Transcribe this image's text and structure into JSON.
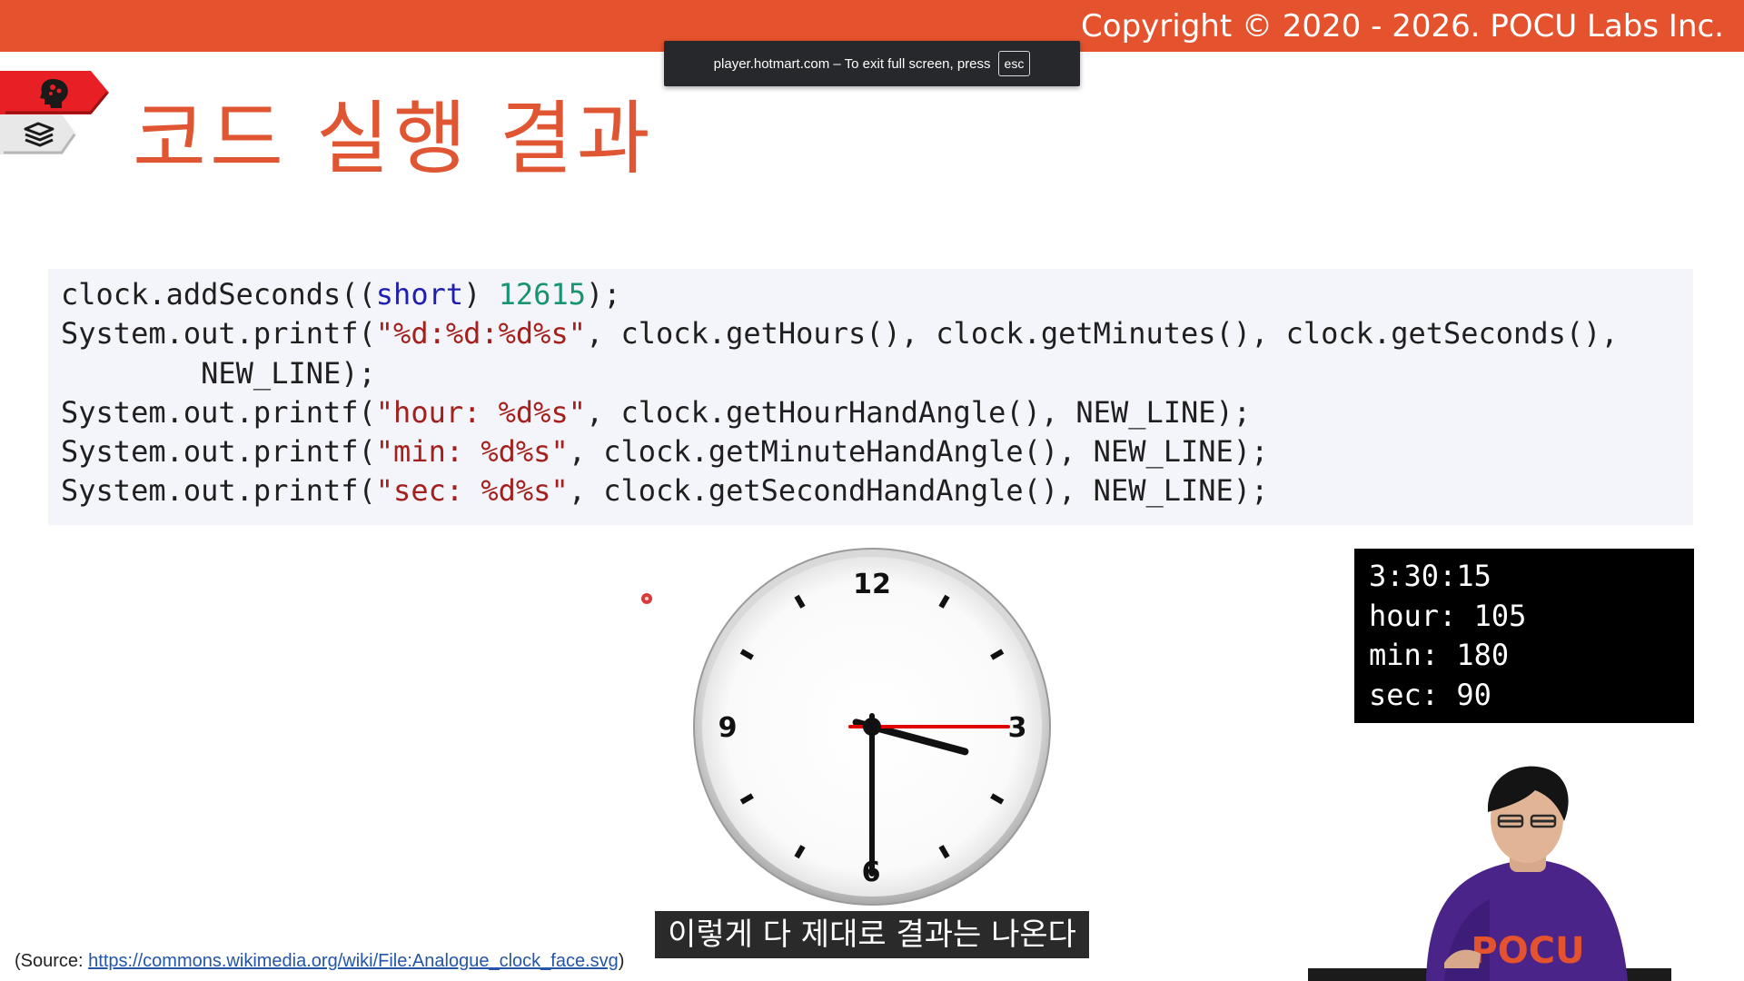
{
  "header": {
    "copyright": "Copyright © 2020 - 2026. POCU Labs Inc."
  },
  "fullscreen_notice": {
    "message": "player.hotmart.com – To exit full screen, press",
    "key": "esc"
  },
  "slide": {
    "title": "코드 실행 결과"
  },
  "code": {
    "lines": [
      [
        {
          "t": "clock.addSeconds(("
        },
        {
          "t": "short",
          "c": "kw"
        },
        {
          "t": ") "
        },
        {
          "t": "12615",
          "c": "num"
        },
        {
          "t": ");"
        }
      ],
      [
        {
          "t": "System.out.printf("
        },
        {
          "t": "\"%d:%d:%d%s\"",
          "c": "str"
        },
        {
          "t": ", clock.getHours(), clock.getMinutes(), clock.getSeconds(),"
        }
      ],
      [
        {
          "t": "        NEW_LINE);"
        }
      ],
      [
        {
          "t": "System.out.printf("
        },
        {
          "t": "\"hour: %d%s\"",
          "c": "str"
        },
        {
          "t": ", clock.getHourHandAngle(), NEW_LINE);"
        }
      ],
      [
        {
          "t": "System.out.printf("
        },
        {
          "t": "\"min: %d%s\"",
          "c": "str"
        },
        {
          "t": ", clock.getMinuteHandAngle(), NEW_LINE);"
        }
      ],
      [
        {
          "t": "System.out.printf("
        },
        {
          "t": "\"sec: %d%s\"",
          "c": "str"
        },
        {
          "t": ", clock.getSecondHandAngle(), NEW_LINE);"
        }
      ]
    ]
  },
  "clock": {
    "numbers": {
      "n12": "12",
      "n3": "3",
      "n6": "6",
      "n9": "9"
    },
    "hour_hand_angle": 105,
    "minute_hand_angle": 180,
    "second_hand_angle": 90,
    "second_hand_color": "#e00000"
  },
  "console": {
    "lines": [
      "3:30:15",
      "hour: 105",
      "min: 180",
      "sec: 90"
    ]
  },
  "subtitle": {
    "text": "이렇게 다 제대로 결과는 나온다"
  },
  "source": {
    "prefix": "(Source: ",
    "link": "https://commons.wikimedia.org/wiki/File:Analogue_clock_face.svg",
    "suffix": ")"
  },
  "colors": {
    "accent": "#e4532d",
    "title": "#e05633",
    "code_bg": "#f4f4fb"
  }
}
